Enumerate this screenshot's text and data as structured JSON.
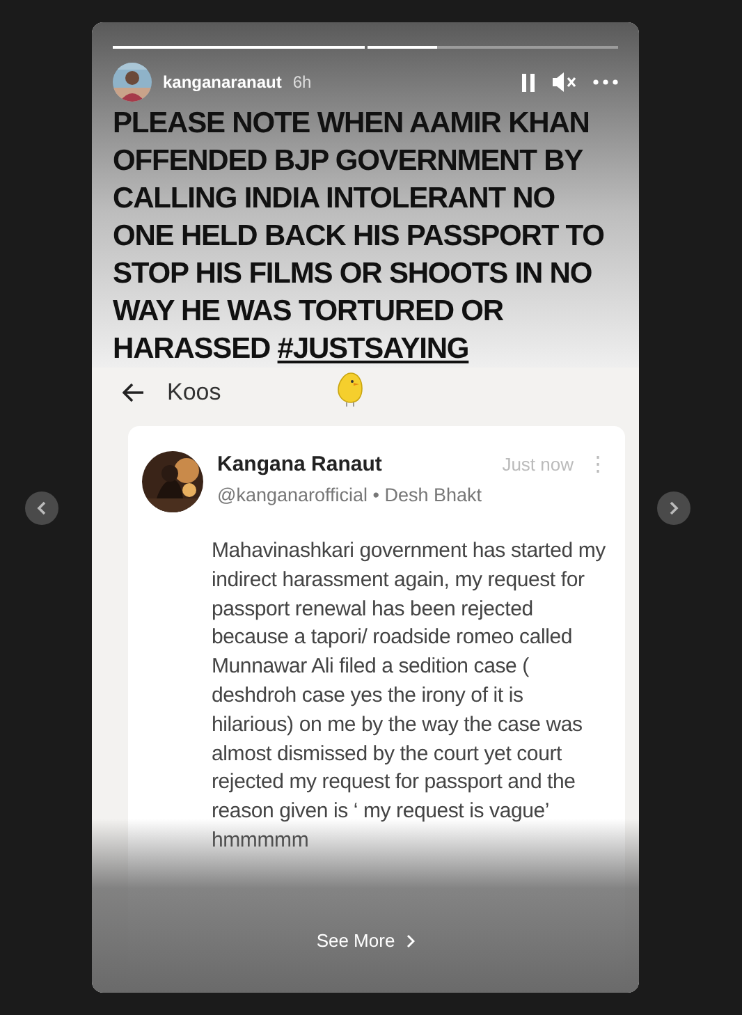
{
  "progress": [
    {
      "level": 1
    },
    {
      "level": 0.28
    }
  ],
  "header": {
    "username": "kanganaranaut",
    "time": "6h"
  },
  "caption": {
    "text": "PLEASE NOTE WHEN AAMIR KHAN OFFENDED BJP GOVERNMENT BY CALLING INDIA INTOLERANT NO ONE HELD BACK HIS PASSPORT TO STOP HIS FILMS OR SHOOTS IN NO WAY HE WAS TORTURED OR HARASSED",
    "hashtag": "#JUSTSAYING"
  },
  "koo_screen": {
    "title": "Koos",
    "post": {
      "author": "Kangana Ranaut",
      "handle_line": "@kanganarofficial • Desh Bhakt",
      "time": "Just now",
      "menu": "⋮",
      "body": "Mahavinashkari government has started my indirect harassment again, my request for passport renewal has been rejected because a tapori/ roadside romeo called Munnawar Ali filed a sedition case ( deshdroh case yes the irony of it is hilarious) on me by the way the case was almost dismissed by the court yet court rejected my request for passport and the reason given is ‘ my request is vague’ hmmmmm"
    }
  },
  "see_more": "See More"
}
